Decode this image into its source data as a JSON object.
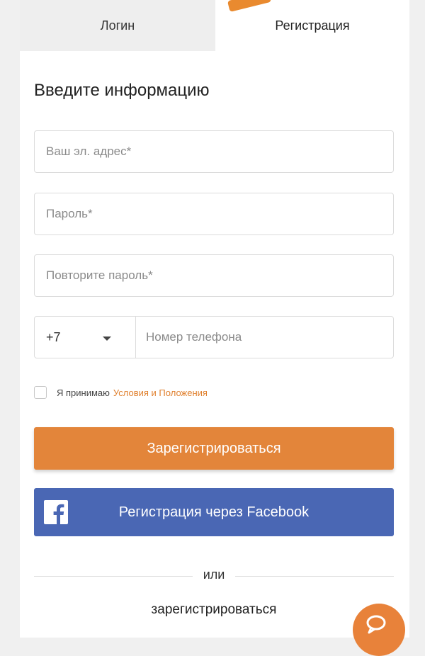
{
  "tabs": {
    "login": "Логин",
    "register": "Регистрация",
    "active": "register"
  },
  "form": {
    "title": "Введите информацию",
    "email_placeholder": "Ваш эл. адрес*",
    "password_placeholder": "Пароль*",
    "repeat_password_placeholder": "Повторите пароль*",
    "country_code": "+7",
    "phone_placeholder": "Номер телефона",
    "terms_prefix": "Я принимаю",
    "terms_link": "Условия и Положения",
    "terms_checked": false
  },
  "buttons": {
    "register": "Зарегистрироваться",
    "facebook": "Регистрация через Facebook"
  },
  "divider_text": "или",
  "bottom_link": "зарегистрироваться",
  "icons": {
    "facebook": "facebook-icon",
    "chat": "chat-icon",
    "dropdown": "chevron-down-icon"
  },
  "colors": {
    "accent": "#e3853a",
    "facebook": "#4a67b4",
    "link": "#e0802e"
  }
}
